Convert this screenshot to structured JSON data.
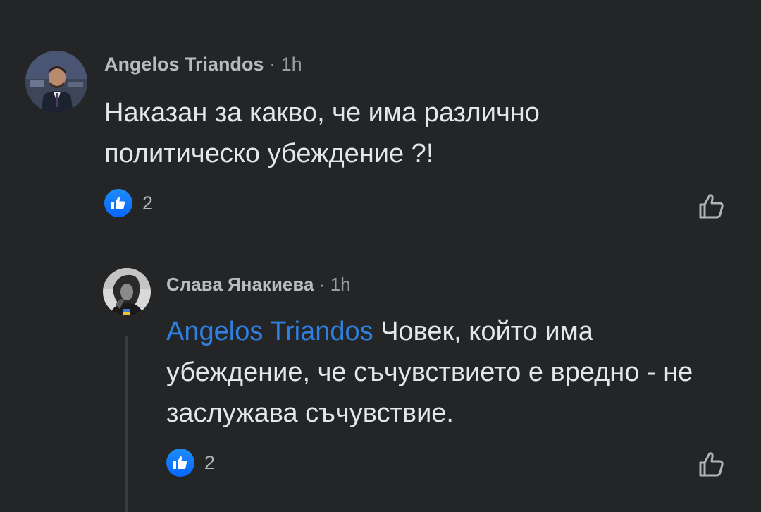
{
  "comments": [
    {
      "author": "Angelos Triandos",
      "separator": "·",
      "time": "1h",
      "text": "Наказан за какво, че има различно политическо убеждение ?!",
      "reaction_count": "2",
      "reaction_icon": "thumbs-up-icon",
      "like_action_icon": "thumbs-up-outline-icon"
    }
  ],
  "replies": [
    {
      "author": "Слава Янакиева",
      "separator": "·",
      "time": "1h",
      "mention": "Angelos Triandos",
      "text": " Човек, който има убеждение, че съчувствието е вредно - не заслужава съчувствие.",
      "reaction_count": "2",
      "reaction_icon": "thumbs-up-icon",
      "like_action_icon": "thumbs-up-outline-icon"
    }
  ],
  "colors": {
    "background": "#242526",
    "mention": "#2f80e2",
    "like_badge": "#0866ff",
    "text": "#e4e6eb",
    "meta": "#b0b3b8"
  }
}
